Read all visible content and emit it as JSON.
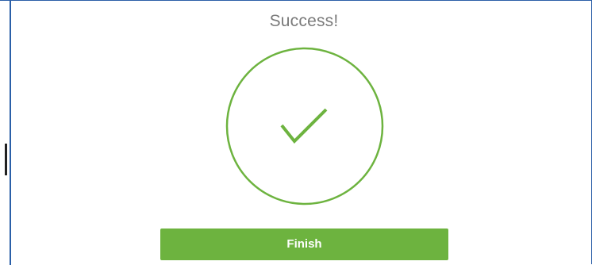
{
  "dialog": {
    "title": "Success!",
    "icon": "checkmark-circle-icon",
    "finish_label": "Finish"
  },
  "colors": {
    "accent": "#6db33f",
    "title_text": "#7a7a7a",
    "window_border": "#2b5fa8"
  }
}
